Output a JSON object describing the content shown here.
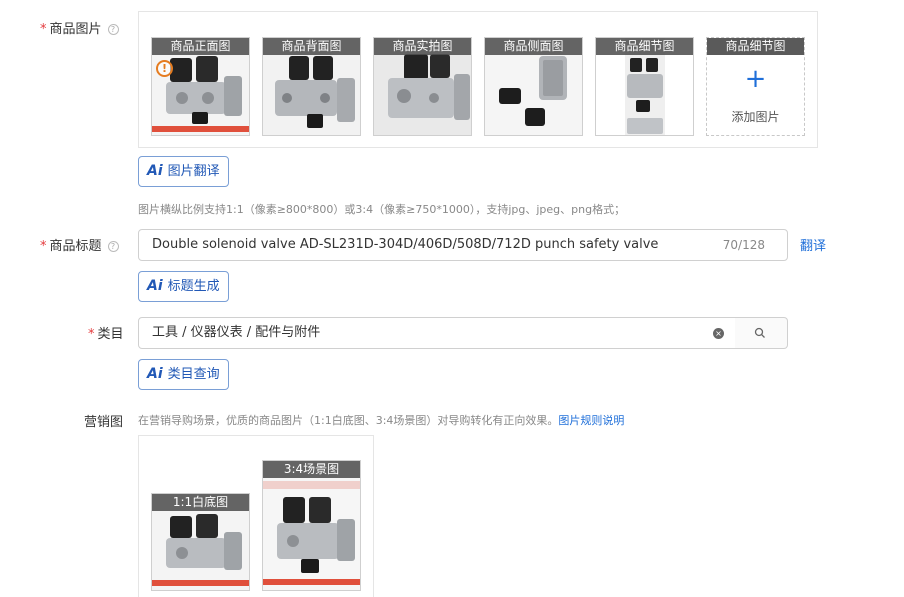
{
  "images": {
    "label": "商品图片",
    "required_mark": "*",
    "help_icon": "?",
    "slots": [
      {
        "caption": "商品正面图",
        "icon": "warning-icon"
      },
      {
        "caption": "商品背面图"
      },
      {
        "caption": "商品实拍图"
      },
      {
        "caption": "商品侧面图"
      },
      {
        "caption": "商品细节图"
      }
    ],
    "add_slot": {
      "caption": "商品细节图",
      "plus": "+",
      "label": "添加图片"
    },
    "ai_translate": {
      "ai": "Ai",
      "label": "图片翻译"
    },
    "hint": "图片横纵比例支持1:1（像素≥800*800）或3:4（像素≥750*1000），支持jpg、jpeg、png格式；"
  },
  "title": {
    "label": "商品标题",
    "required_mark": "*",
    "help_icon": "?",
    "value": "Double solenoid valve AD-SL231D-304D/406D/508D/712D punch safety valve",
    "count": "70/128",
    "translate_link": "翻译",
    "ai_generate": {
      "ai": "Ai",
      "label": "标题生成"
    }
  },
  "category": {
    "label": "类目",
    "required_mark": "*",
    "value": "工具 / 仪器仪表 / 配件与附件",
    "clear_icon": "×",
    "ai_query": {
      "ai": "Ai",
      "label": "类目查询"
    }
  },
  "marketing": {
    "label": "营销图",
    "hint": "在营销导购场景，优质的商品图片（1:1白底图、3:4场景图）对导购转化有正向效果。",
    "rules_link": "图片规则说明",
    "slots": [
      {
        "caption": "1:1白底图"
      },
      {
        "caption": "3:4场景图"
      }
    ]
  },
  "colors": {
    "accent": "#1f6fd9",
    "required": "#e4393c",
    "caption_bg": "#5a5a5a"
  }
}
